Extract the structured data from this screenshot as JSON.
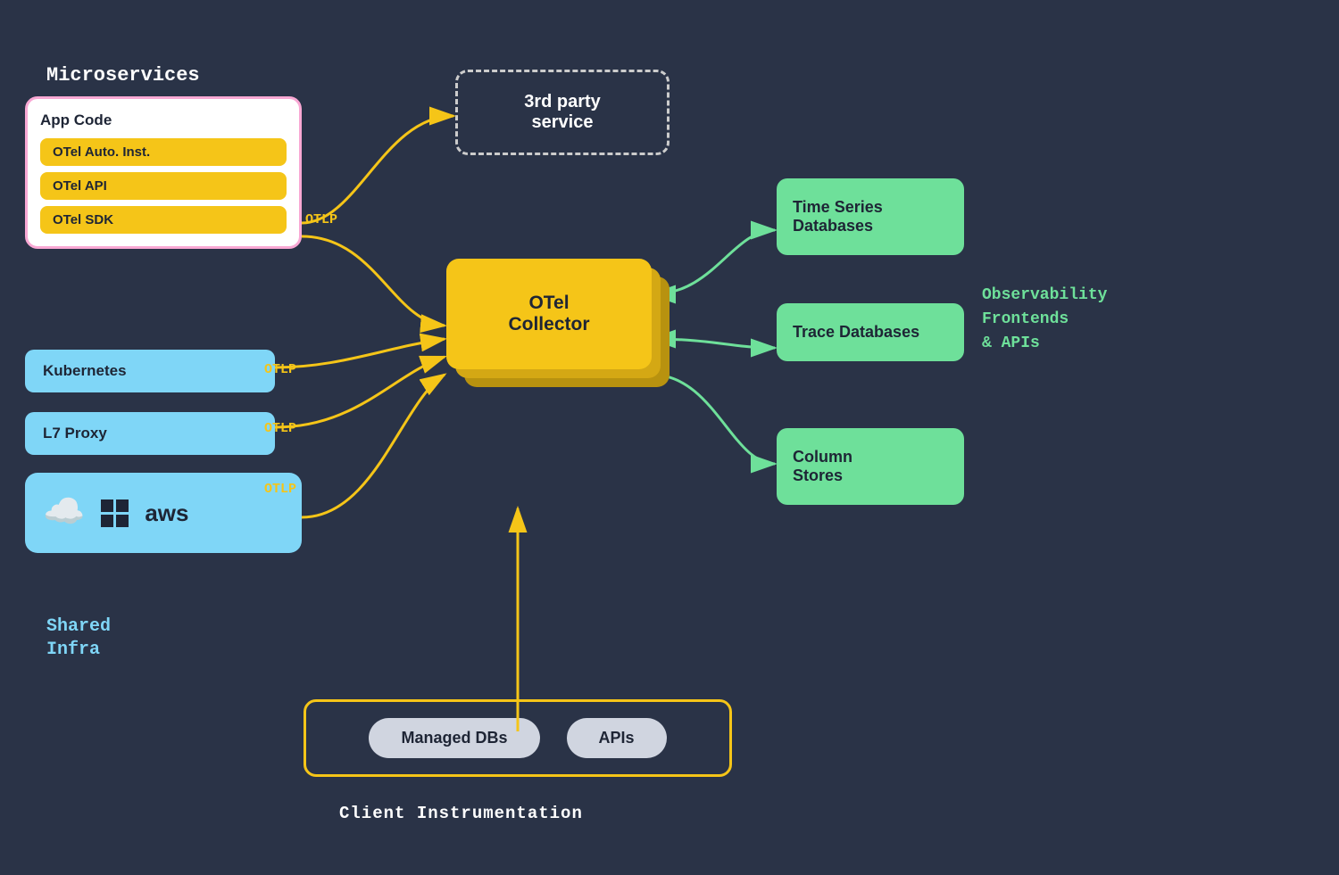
{
  "labels": {
    "microservices": "Microservices",
    "app_code": "App Code",
    "otel_auto": "OTel Auto. Inst.",
    "otel_api": "OTel API",
    "otel_sdk": "OTel SDK",
    "kubernetes": "Kubernetes",
    "l7_proxy": "L7 Proxy",
    "shared_infra": "Shared\nInfra",
    "third_party": "3rd party\nservice",
    "otel_collector": "OTel\nCollector",
    "time_series": "Time Series\nDatabases",
    "trace_databases": "Trace\nDatabases",
    "column_stores": "Column\nStores",
    "observability": "Observability\nFrontends\n& APIs",
    "managed_dbs": "Managed DBs",
    "apis": "APIs",
    "client_instr": "Client Instrumentation",
    "otlp1": "OTLP",
    "otlp2": "OTLP",
    "otlp3": "OTLP",
    "otlp4": "OTLP"
  }
}
